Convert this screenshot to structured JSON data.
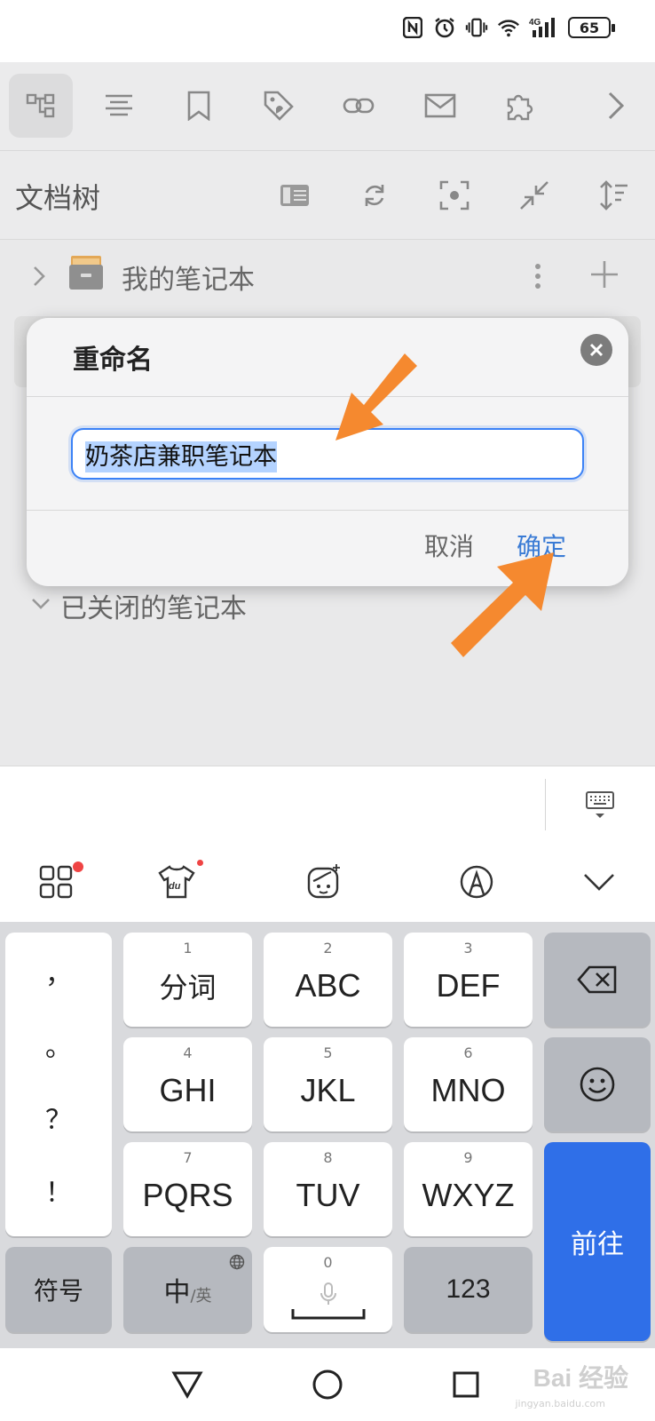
{
  "status_bar": {
    "battery": "65",
    "network": "4G"
  },
  "toolbar": {
    "icons": [
      "doc-tree-icon",
      "outline-icon",
      "bookmark-icon",
      "tag-icon",
      "link-icon",
      "mail-icon",
      "plugin-icon",
      "chevron-right-icon"
    ]
  },
  "doc_tree": {
    "title": "文档树",
    "notebook": "我的笔记本",
    "closed_section": "已关闭的笔记本"
  },
  "rename_dialog": {
    "title": "重命名",
    "value": "奶茶店兼职笔记本",
    "cancel": "取消",
    "confirm": "确定"
  },
  "keyboard": {
    "punctuation": [
      "，",
      "。",
      "？",
      "！"
    ],
    "keys": [
      {
        "num": "1",
        "label": "分词"
      },
      {
        "num": "2",
        "label": "ABC"
      },
      {
        "num": "3",
        "label": "DEF"
      },
      {
        "num": "4",
        "label": "GHI"
      },
      {
        "num": "5",
        "label": "JKL"
      },
      {
        "num": "6",
        "label": "MNO"
      },
      {
        "num": "7",
        "label": "PQRS"
      },
      {
        "num": "8",
        "label": "TUV"
      },
      {
        "num": "9",
        "label": "WXYZ"
      }
    ],
    "symbols": "符号",
    "lang_main": "中",
    "lang_sub": "/英",
    "zero": "0",
    "numbers": "123",
    "go": "前往"
  },
  "watermark": {
    "text": "Bai 经验",
    "sub": "jingyan.baidu.com"
  },
  "colors": {
    "accent": "#2f6fe8",
    "arrow": "#f5892f",
    "confirm": "#3a7bd5"
  }
}
